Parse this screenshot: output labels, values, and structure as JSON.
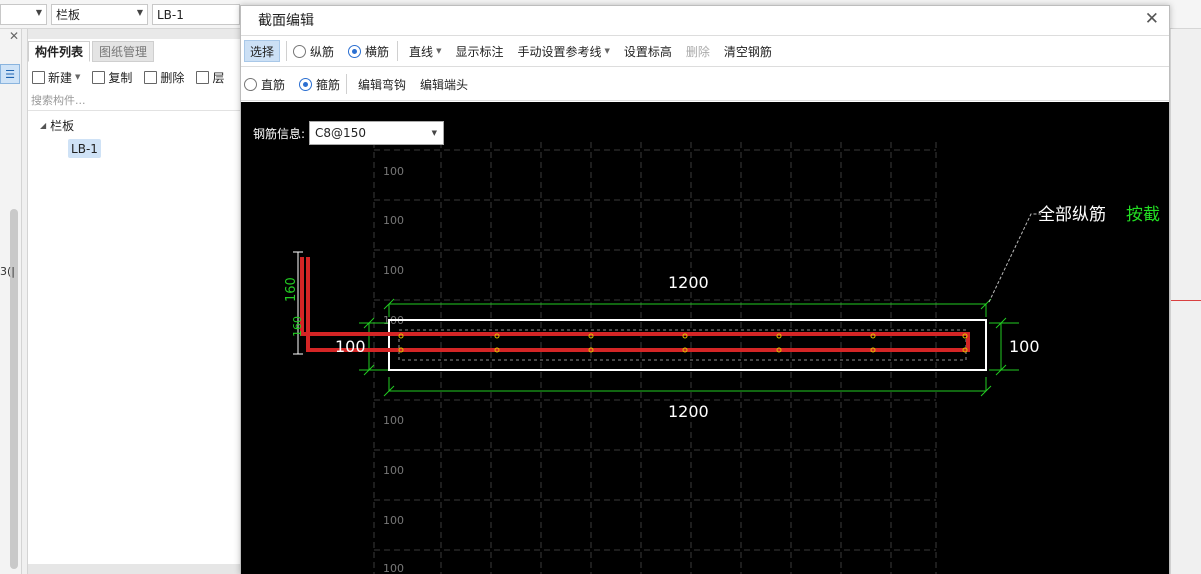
{
  "top_bar": {
    "select_1": "",
    "category_select": "栏板",
    "name_field": "LB-1"
  },
  "left_strip": {
    "fragment_text": "3(|"
  },
  "component_panel": {
    "tabs": [
      "构件列表",
      "图纸管理"
    ],
    "toolbar": {
      "new_label": "新建",
      "copy_label": "复制",
      "delete_label": "删除",
      "layer_label": "层"
    },
    "search_placeholder": "搜索构件...",
    "tree": {
      "root_label": "栏板",
      "items": [
        "LB-1"
      ]
    }
  },
  "dialog": {
    "title": "截面编辑",
    "toolbar_row1": {
      "select": "选择",
      "longitudinal": "纵筋",
      "transverse": "横筋",
      "line": "直线",
      "show_dims": "显示标注",
      "manual_ref": "手动设置参考线",
      "set_elevation": "设置标高",
      "delete": "删除",
      "clear_rebar": "清空钢筋"
    },
    "toolbar_row2": {
      "straight": "直筋",
      "stirrup": "箍筋",
      "edit_hook": "编辑弯钩",
      "edit_end": "编辑端头"
    },
    "rebar_info_label": "钢筋信息:",
    "rebar_info_value": "C8@150"
  },
  "drawing": {
    "grid_labels": [
      "100",
      "100",
      "100",
      "100",
      "100",
      "100",
      "100",
      "100"
    ],
    "dim_top": "1200",
    "dim_bottom": "1200",
    "dim_right": "100",
    "dim_left": "100",
    "dim_vert_1": "160",
    "dim_vert_2": "160",
    "annotation_main": "全部纵筋",
    "annotation_highlight": "按截",
    "colors": {
      "rebar": "#d42525",
      "section": "#ffffff",
      "dimension": "#22cc22",
      "grid": "#3a3a3a"
    }
  }
}
